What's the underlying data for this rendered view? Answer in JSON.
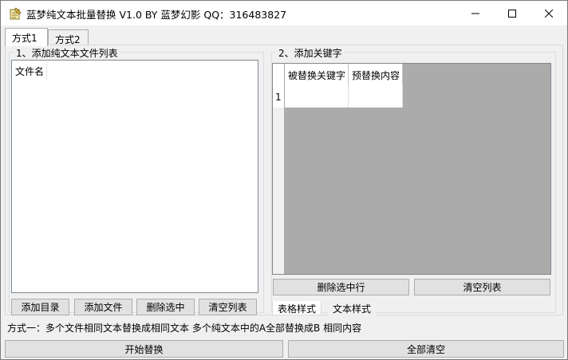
{
  "window": {
    "title": "蓝梦纯文本批量替换 V1.0 BY 蓝梦幻影 QQ：316483827"
  },
  "tabs": [
    {
      "label": "方式1",
      "active": true
    },
    {
      "label": "方式2",
      "active": false
    }
  ],
  "group_files": {
    "label": "1、添加纯文本文件列表",
    "column_header": "文件名",
    "buttons": [
      "添加目录",
      "添加文件",
      "删除选中",
      "清空列表"
    ]
  },
  "group_keywords": {
    "label": "2、添加关键字",
    "columns": [
      "被替换关键字",
      "预替换内容"
    ],
    "row_numbers": [
      "1"
    ],
    "buttons": [
      "删除选中行",
      "清空列表"
    ],
    "subtabs": [
      "表格样式",
      "文本样式"
    ]
  },
  "description": "方式一：多个文件相同文本替换成相同文本   多个纯文本中的A全部替换成B 相同内容",
  "bottom_buttons": [
    "开始替换",
    "全部清空"
  ],
  "icons": {
    "app": "notepad-icon",
    "minimize": "minimize-icon",
    "maximize": "maximize-icon",
    "close": "close-icon"
  },
  "colors": {
    "titlebar": "#ffffff",
    "window_bg": "#f0f0f0",
    "button_bg": "#e1e1e1",
    "grid_bg": "#ababab"
  }
}
